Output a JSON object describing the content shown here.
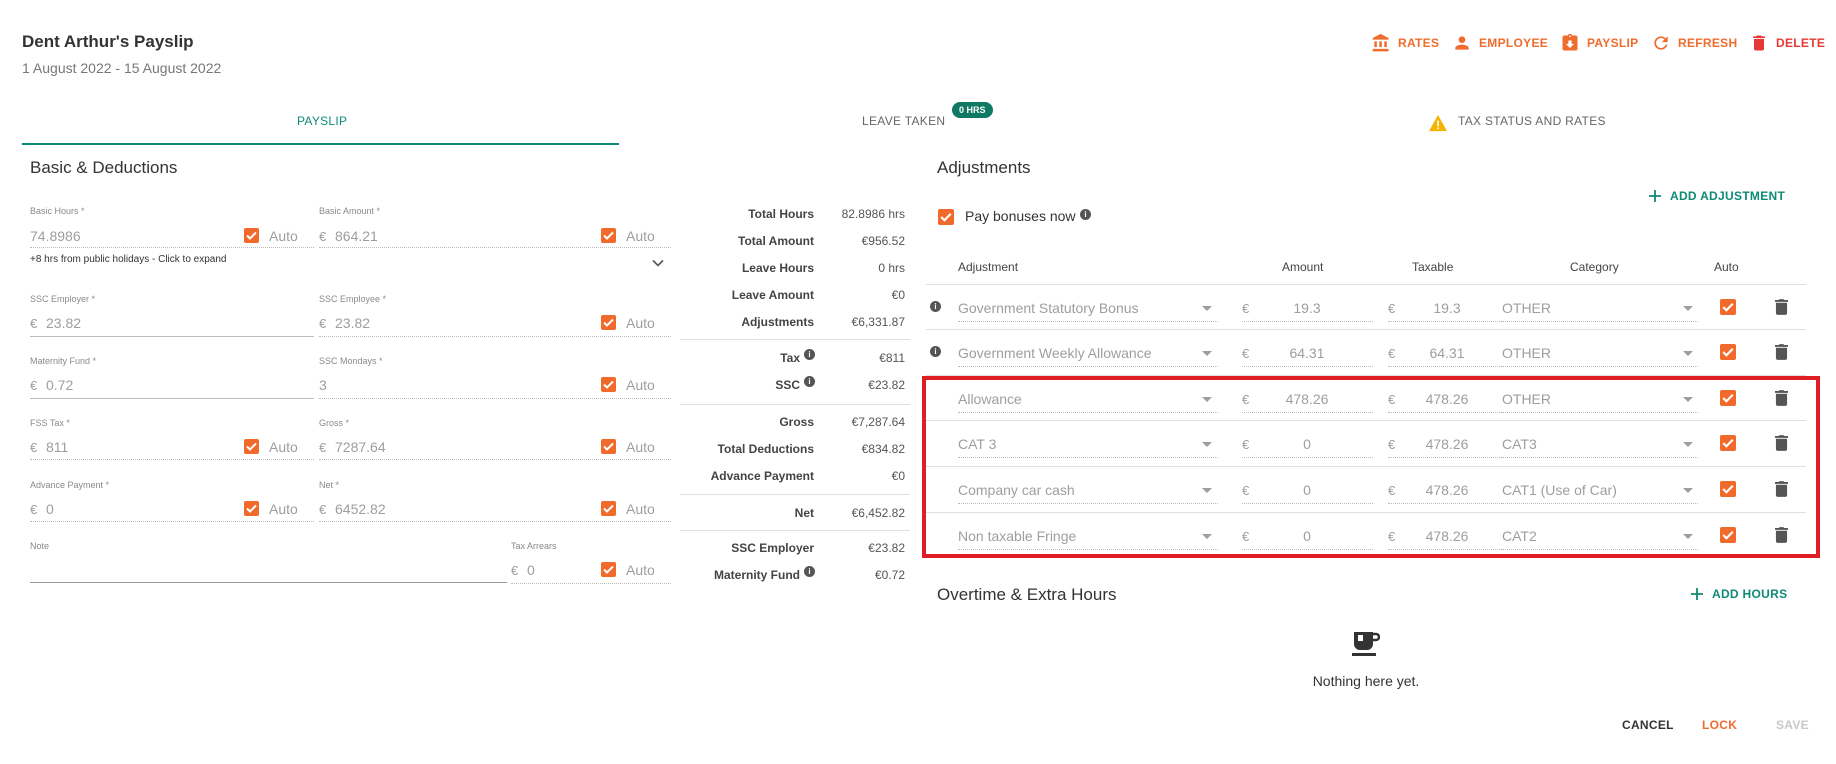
{
  "header": {
    "title": "Dent Arthur's Payslip",
    "period": "1 August 2022 - 15 August 2022",
    "actions": {
      "rates": "RATES",
      "employee": "EMPLOYEE",
      "payslip": "PAYSLIP",
      "refresh": "REFRESH",
      "delete": "DELETE"
    }
  },
  "tabs": {
    "payslip": "PAYSLIP",
    "leave": "LEAVE TAKEN",
    "leave_badge": "0 HRS",
    "tax": "TAX STATUS AND RATES"
  },
  "basic": {
    "title": "Basic & Deductions",
    "auto_label": "Auto",
    "currency": "€",
    "basic_hours": {
      "label": "Basic Hours *",
      "value": "74.8986"
    },
    "basic_amount": {
      "label": "Basic Amount *",
      "value": "864.21"
    },
    "holiday_hint": "+8 hrs from public holidays - Click to expand",
    "ssc_employer": {
      "label": "SSC Employer *",
      "value": "23.82"
    },
    "ssc_employee": {
      "label": "SSC Employee *",
      "value": "23.82"
    },
    "maternity_fund": {
      "label": "Maternity Fund *",
      "value": "0.72"
    },
    "ssc_mondays": {
      "label": "SSC Mondays *",
      "value": "3"
    },
    "fss_tax": {
      "label": "FSS Tax *",
      "value": "811"
    },
    "gross": {
      "label": "Gross *",
      "value": "7287.64"
    },
    "advance_payment": {
      "label": "Advance Payment *",
      "value": "0"
    },
    "net": {
      "label": "Net *",
      "value": "6452.82"
    },
    "note": {
      "label": "Note",
      "value": ""
    },
    "tax_arrears": {
      "label": "Tax Arrears",
      "value": "0"
    }
  },
  "totals": [
    {
      "label": "Total Hours",
      "value": "82.8986 hrs"
    },
    {
      "label": "Total Amount",
      "value": "€956.52"
    },
    {
      "label": "Leave Hours",
      "value": "0 hrs"
    },
    {
      "label": "Leave Amount",
      "value": "€0"
    },
    {
      "label": "Adjustments",
      "value": "€6,331.87"
    },
    {
      "label": "Tax",
      "value": "€811"
    },
    {
      "label": "SSC",
      "value": "€23.82"
    },
    {
      "label": "Gross",
      "value": "€7,287.64"
    },
    {
      "label": "Total Deductions",
      "value": "€834.82"
    },
    {
      "label": "Advance Payment",
      "value": "€0"
    },
    {
      "label": "Net",
      "value": "€6,452.82"
    },
    {
      "label": "SSC Employer",
      "value": "€23.82"
    },
    {
      "label": "Maternity Fund",
      "value": "€0.72"
    }
  ],
  "adjustments": {
    "title": "Adjustments",
    "add_label": "ADD ADJUSTMENT",
    "pay_bonuses_label": "Pay bonuses now",
    "columns": {
      "adjustment": "Adjustment",
      "amount": "Amount",
      "taxable": "Taxable",
      "category": "Category",
      "auto": "Auto"
    },
    "currency": "€",
    "rows": [
      {
        "name": "Government Statutory Bonus",
        "amount": "19.3",
        "taxable": "19.3",
        "category": "OTHER",
        "info": true
      },
      {
        "name": "Government Weekly Allowance",
        "amount": "64.31",
        "taxable": "64.31",
        "category": "OTHER",
        "info": true
      },
      {
        "name": "Allowance",
        "amount": "478.26",
        "taxable": "478.26",
        "category": "OTHER",
        "info": false
      },
      {
        "name": "CAT 3",
        "amount": "0",
        "taxable": "478.26",
        "category": "CAT3",
        "info": false
      },
      {
        "name": "Company car cash",
        "amount": "0",
        "taxable": "478.26",
        "category": "CAT1 (Use of Car)",
        "info": false
      },
      {
        "name": "Non taxable Fringe",
        "amount": "0",
        "taxable": "478.26",
        "category": "CAT2",
        "info": false
      }
    ]
  },
  "overtime": {
    "title": "Overtime & Extra Hours",
    "add_label": "ADD HOURS",
    "empty_text": "Nothing here yet."
  },
  "footer": {
    "cancel": "CANCEL",
    "lock": "LOCK",
    "save": "SAVE"
  },
  "colors": {
    "accent": "#f06b2e",
    "primary": "#0f8a76",
    "danger": "#e53935",
    "highlight": "#e01e26"
  }
}
